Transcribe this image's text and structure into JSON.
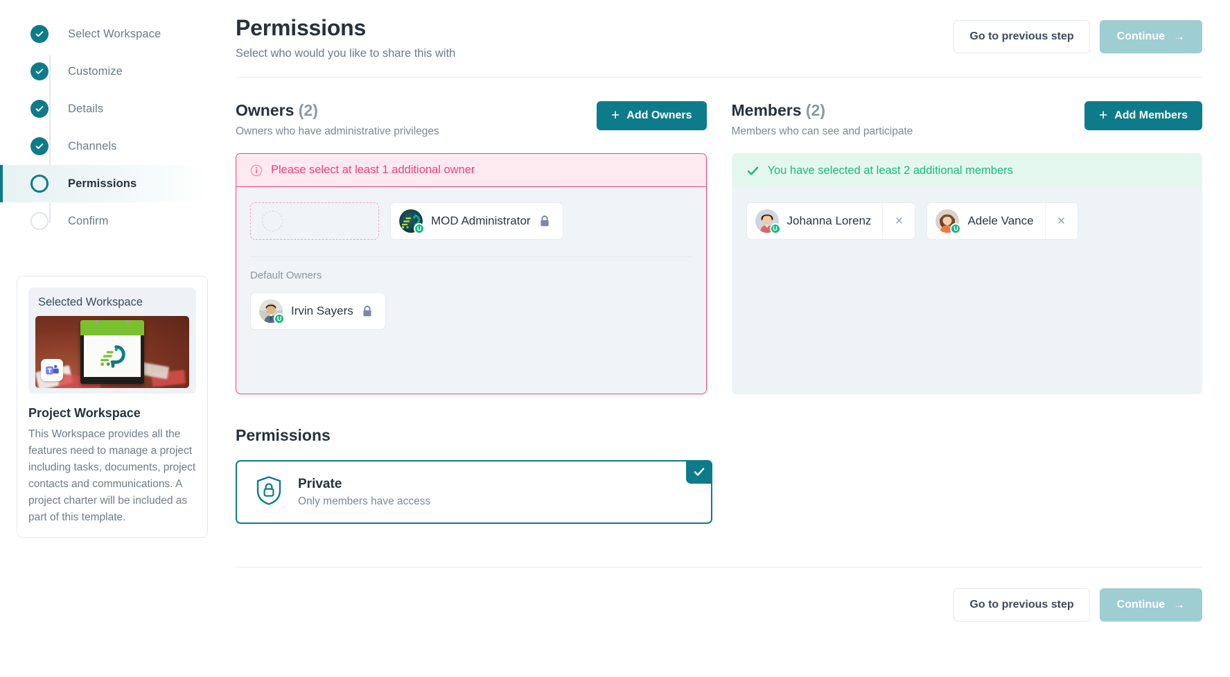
{
  "sidebar": {
    "steps": [
      {
        "label": "Select Workspace",
        "state": "done"
      },
      {
        "label": "Customize",
        "state": "done"
      },
      {
        "label": "Details",
        "state": "done"
      },
      {
        "label": "Channels",
        "state": "done"
      },
      {
        "label": "Permissions",
        "state": "current"
      },
      {
        "label": "Confirm",
        "state": "upcoming"
      }
    ],
    "workspace_card": {
      "eyebrow": "Selected Workspace",
      "title": "Project Workspace",
      "description": "This Workspace provides all the features need to manage a project including tasks, documents, project contacts and communications. A project charter will be included as part of this template.",
      "badge_icon": "microsoft-teams-icon"
    }
  },
  "header": {
    "title": "Permissions",
    "subtitle": "Select who would you like to share this with",
    "previous_label": "Go to previous step",
    "continue_label": "Continue",
    "continue_disabled": true
  },
  "owners": {
    "title": "Owners",
    "count": "(2)",
    "subtitle": "Owners who have administrative privileges",
    "add_label": "Add Owners",
    "banner": {
      "type": "error",
      "icon": "info-circle-icon",
      "text": "Please select at least 1 additional owner"
    },
    "empty_slot_present": true,
    "chips": [
      {
        "name": "MOD Administrator",
        "locked": true,
        "presence": "U"
      }
    ],
    "default_label": "Default Owners",
    "default_chips": [
      {
        "name": "Irvin Sayers",
        "locked": true,
        "presence": "U"
      }
    ]
  },
  "members": {
    "title": "Members",
    "count": "(2)",
    "subtitle": "Members who can see and participate",
    "add_label": "Add Members",
    "banner": {
      "type": "success",
      "icon": "check-icon",
      "text": "You have selected at least 2 additional members"
    },
    "chips": [
      {
        "name": "Johanna Lorenz",
        "presence": "U",
        "remove_label": "×"
      },
      {
        "name": "Adele Vance",
        "presence": "U",
        "remove_label": "×"
      }
    ]
  },
  "permissions": {
    "heading": "Permissions",
    "selected": {
      "name": "Private",
      "description": "Only members have access",
      "icon": "shield-lock-icon",
      "checked": true
    }
  },
  "footer": {
    "previous_label": "Go to previous step",
    "continue_label": "Continue",
    "continue_disabled": true
  },
  "colors": {
    "accent_teal": "#0e7b8a",
    "accent_teal_disabled": "#9ecdd2",
    "error_pink": "#f2407c",
    "error_bg": "#fde9f0",
    "success_green": "#18b981",
    "success_bg": "#e4f7ee",
    "panel_bg": "#eef3f6"
  }
}
